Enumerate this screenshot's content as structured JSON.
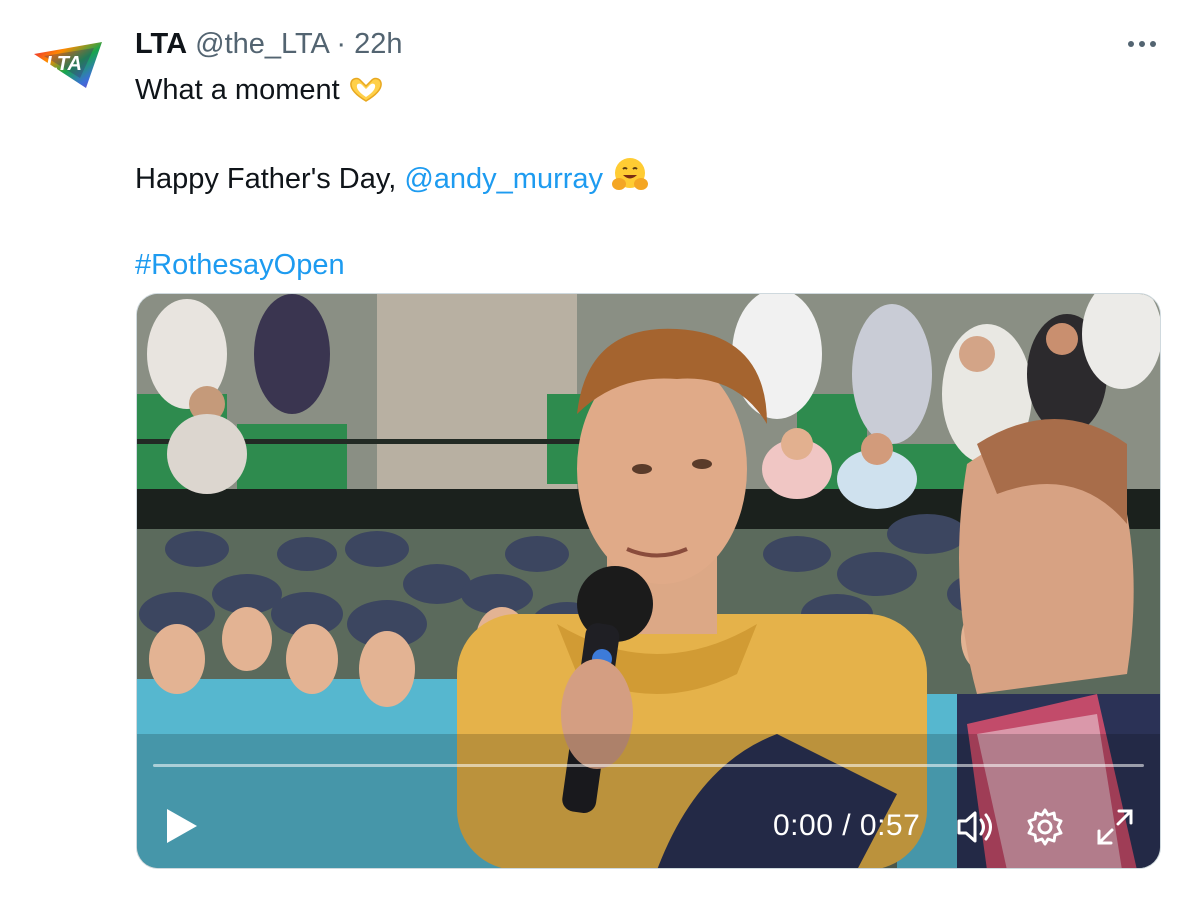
{
  "tweet": {
    "author_name": "LTA",
    "author_handle": "@the_LTA",
    "separator": "·",
    "time": "22h",
    "avatar_logo_text": "LTA",
    "line1_text": "What a moment ",
    "line1_emoji": "heart-hands",
    "line2_text": "Happy Father's Day, ",
    "line2_mention": "@andy_murray",
    "line2_emoji": "hugging-face",
    "hashtag": "#RothesayOpen"
  },
  "video": {
    "current_time": "0:00",
    "duration": "0:57",
    "time_display": "0:00 / 0:57",
    "progress": 0.0
  },
  "colors": {
    "link": "#1d9bf0",
    "secondary_text": "#536471",
    "shirt_ballkid": "#56b7cf",
    "shirt_player": "#e5b24a",
    "cap": "#3c4660",
    "seat_green": "#2e8b4e"
  },
  "icons": {
    "more": "more-horizontal-icon",
    "play": "play-icon",
    "volume": "volume-icon",
    "settings": "settings-gear-icon",
    "fullscreen": "fullscreen-icon"
  }
}
